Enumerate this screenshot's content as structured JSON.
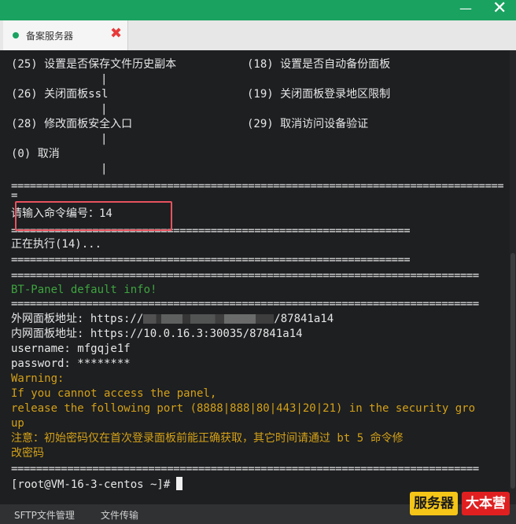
{
  "window": {
    "minimize_glyph": "—",
    "close_glyph": "✕"
  },
  "tab": {
    "label": "备案服务器",
    "close_glyph": "✖"
  },
  "terminal": {
    "menu": {
      "left": [
        "(25) 设置是否保存文件历史副本",
        "(26) 关闭面板ssl",
        "(28) 修改面板安全入口",
        "(0) 取消"
      ],
      "right": [
        "(18) 设置是否自动备份面板",
        "(19) 关闭面板登录地区限制",
        "(29) 取消访问设备验证"
      ]
    },
    "sep_long": "===============================================================================",
    "sep_short": "================================================================",
    "sep_mid": "===========================================================================",
    "prompt_input_label": "请输入命令编号：",
    "prompt_input_value": "14",
    "executing": "正在执行(14)...",
    "panel_title": "BT-Panel default info!",
    "external_label": "外网面板地址: https://",
    "external_suffix": "/87841a14",
    "internal": "内网面板地址: https://10.0.16.3:30035/87841a14",
    "username": "username: mfgqje1f",
    "password": "password: ********",
    "warning_title": "Warning:",
    "warning_1": "If you cannot access the panel,",
    "warning_2": "release the following port (8888|888|80|443|20|21) in the security gro",
    "warning_3": "up",
    "note_1": "注意：初始密码仅在首次登录面板前能正确获取，其它时间请通过 bt 5 命令修",
    "note_2": "改密码",
    "shell_prompt": "[root@VM-16-3-centos ~]#"
  },
  "bottombar": {
    "sftp": "SFTP文件管理",
    "transfer": "文件传输"
  },
  "watermark": {
    "part1": "服务器",
    "part2": "大本营",
    "color1": "#f5c518",
    "color2": "#e02020"
  },
  "colors": {
    "titlebar": "#1aa260",
    "terminal_bg": "#1d1f21",
    "green_text": "#3fa43f",
    "orange_text": "#d4a017",
    "highlight_box": "#e8525f"
  }
}
